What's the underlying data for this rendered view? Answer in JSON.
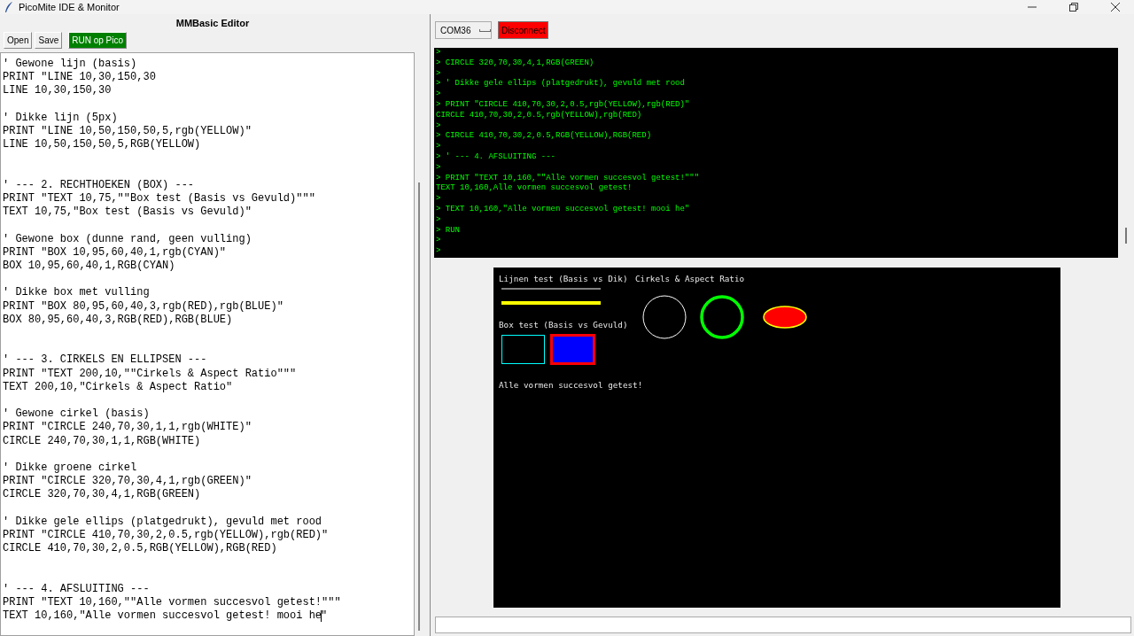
{
  "window": {
    "title": "PicoMite IDE & Monitor"
  },
  "editor": {
    "title": "MMBasic Editor",
    "buttons": [
      {
        "label": "Open",
        "kind": "plain"
      },
      {
        "label": "Save",
        "kind": "plain"
      },
      {
        "label": "RUN op Pico",
        "kind": "run"
      }
    ],
    "blocks": [
      {
        "kind": "block",
        "lines": [
          "' Gewone lijn (basis)",
          "PRINT \"LINE 10,30,150,30",
          "LINE 10,30,150,30"
        ]
      },
      {
        "kind": "block",
        "lines": [
          "' Dikke lijn (5px)",
          "PRINT \"LINE 10,50,150,50,5,rgb(YELLOW)\"",
          "LINE 10,50,150,50,5,RGB(YELLOW)"
        ]
      },
      {
        "kind": "section",
        "lines": [
          "' --- 2. RECHTHOEKEN (BOX) ---",
          "PRINT \"TEXT 10,75,\"\"Box test (Basis vs Gevuld)\"\"\"",
          "TEXT 10,75,\"Box test (Basis vs Gevuld)\""
        ]
      },
      {
        "kind": "block",
        "lines": [
          "' Gewone box (dunne rand, geen vulling)",
          "PRINT \"BOX 10,95,60,40,1,rgb(CYAN)\"",
          "BOX 10,95,60,40,1,RGB(CYAN)"
        ]
      },
      {
        "kind": "block",
        "lines": [
          "' Dikke box met vulling",
          "PRINT \"BOX 80,95,60,40,3,rgb(RED),rgb(BLUE)\"",
          "BOX 80,95,60,40,3,RGB(RED),RGB(BLUE)"
        ]
      },
      {
        "kind": "section",
        "lines": [
          "' --- 3. CIRKELS EN ELLIPSEN ---",
          "PRINT \"TEXT 200,10,\"\"Cirkels & Aspect Ratio\"\"\"",
          "TEXT 200,10,\"Cirkels & Aspect Ratio\""
        ]
      },
      {
        "kind": "block",
        "lines": [
          "' Gewone cirkel (basis)",
          "PRINT \"CIRCLE 240,70,30,1,1,rgb(WHITE)\"",
          "CIRCLE 240,70,30,1,1,RGB(WHITE)"
        ]
      },
      {
        "kind": "block",
        "lines": [
          "' Dikke groene cirkel",
          "PRINT \"CIRCLE 320,70,30,4,1,rgb(GREEN)\"",
          "CIRCLE 320,70,30,4,1,RGB(GREEN)"
        ]
      },
      {
        "kind": "block",
        "lines": [
          "' Dikke gele ellips (platgedrukt), gevuld met rood",
          "PRINT \"CIRCLE 410,70,30,2,0.5,rgb(YELLOW),rgb(RED)\"",
          "CIRCLE 410,70,30,2,0.5,RGB(YELLOW),RGB(RED)"
        ]
      },
      {
        "kind": "section",
        "has_caret": true,
        "lines": [
          "' --- 4. AFSLUITING ---",
          "PRINT \"TEXT 10,160,\"\"Alle vormen succesvol getest!\"\"\"",
          "TEXT 10,160,\"Alle vormen succesvol getest! mooi he\""
        ]
      }
    ]
  },
  "monitor": {
    "port": "COM36",
    "disconnect_button": "Disconnect",
    "console_lines": [
      ">",
      "> CIRCLE 320,70,30,4,1,RGB(GREEN)",
      ">",
      "> ' Dikke gele ellips (platgedrukt), gevuld met rood",
      ">",
      "> PRINT \"CIRCLE 410,70,30,2,0.5,rgb(YELLOW),rgb(RED)\"",
      "CIRCLE 410,70,30,2,0.5,rgb(YELLOW),rgb(RED)",
      ">",
      "> CIRCLE 410,70,30,2,0.5,RGB(YELLOW),RGB(RED)",
      ">",
      "> ' --- 4. AFSLUITING ---",
      ">",
      "> PRINT \"TEXT 10,160,\"\"Alle vormen succesvol getest!\"\"\"",
      "TEXT 10,160,Alle vormen succesvol getest!",
      ">",
      "> TEXT 10,160,\"Alle vormen succesvol getest! mooi he\"",
      ">",
      "> RUN",
      ">",
      ">"
    ],
    "display_texts": [
      "Lijnen test (Basis vs Dik)",
      "Cirkels & Aspect Ratio",
      "Box test (Basis vs Gevuld)",
      "Alle vormen succesvol getest!"
    ]
  }
}
